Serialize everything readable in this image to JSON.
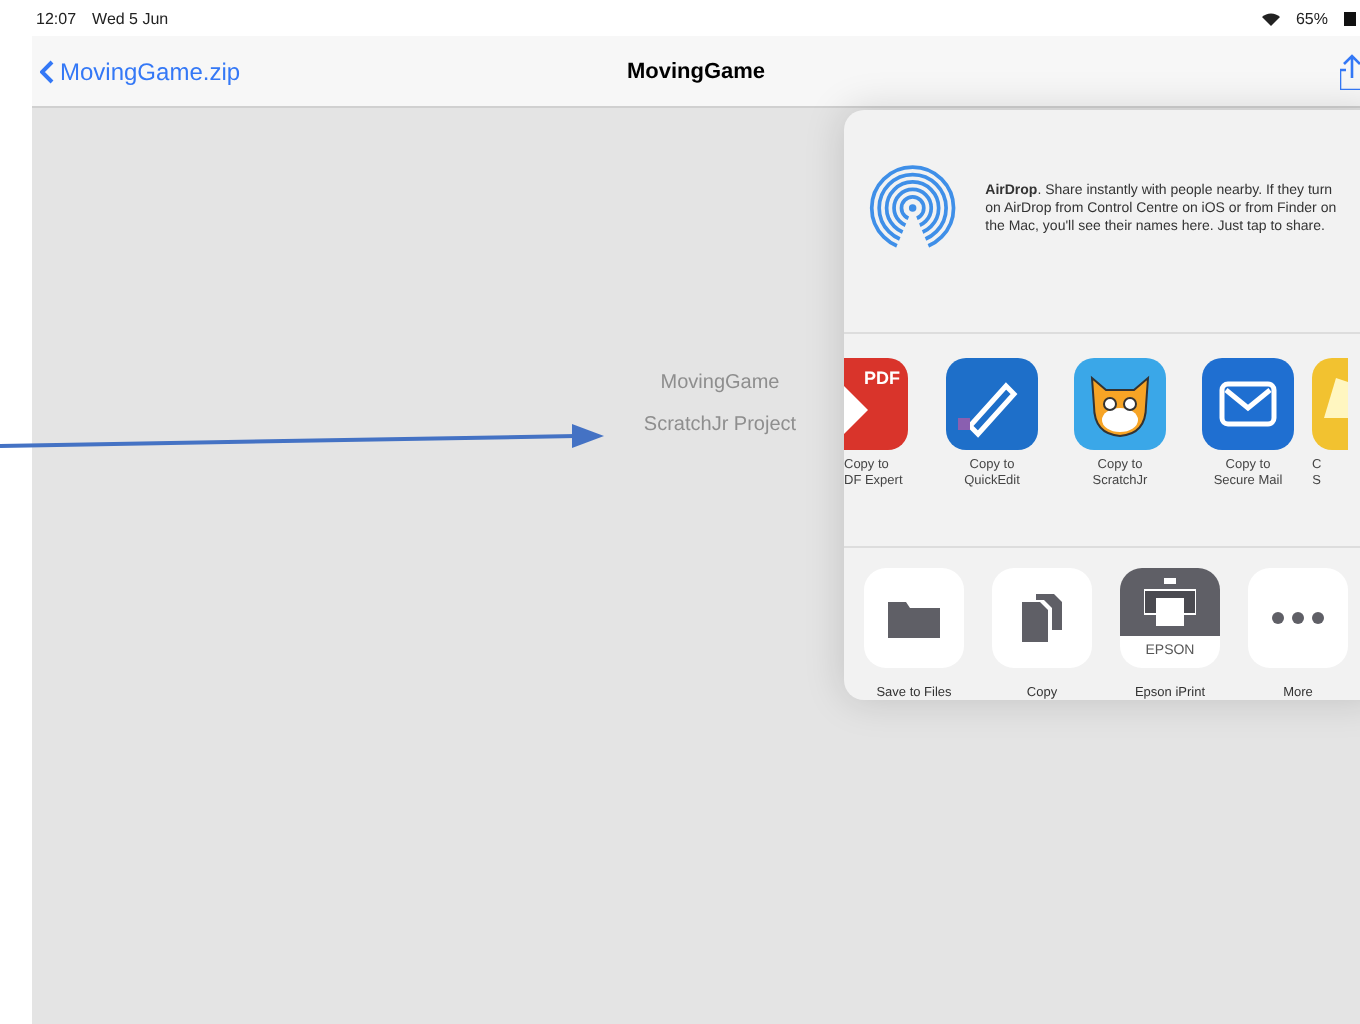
{
  "status_bar": {
    "time": "12:07",
    "date": "Wed 5 Jun",
    "battery": "65%"
  },
  "nav_bar": {
    "back": "MovingGame.zip",
    "title": "MovingGame"
  },
  "file": {
    "name": "MovingGame",
    "type": "ScratchJr Project"
  },
  "share_sheet": {
    "airdrop": "**AirDrop**. Share instantly with people nearby. If they turn on AirDrop from Control Centre on iOS or from Finder on the Mac, you'll see their names here. Just tap to share.",
    "apps": [
      {
        "kind": "pdf",
        "badge": "PDF",
        "line1": "Copy to",
        "line2": "DF Expert"
      },
      {
        "kind": "quickedit",
        "line1": "Copy to",
        "line2": "QuickEdit"
      },
      {
        "kind": "scratchjr",
        "line1": "Copy to",
        "line2": "ScratchJr"
      },
      {
        "kind": "securemail",
        "line1": "Copy to",
        "line2": "Secure Mail"
      },
      {
        "kind": "partial",
        "line1": "C",
        "line2": "S"
      }
    ],
    "actions": [
      {
        "kind": "folder",
        "label": "Save to Files"
      },
      {
        "kind": "copy",
        "label": "Copy"
      },
      {
        "kind": "printer",
        "badge": "EPSON",
        "label": "Epson iPrint"
      },
      {
        "kind": "more",
        "label": "More"
      }
    ]
  }
}
